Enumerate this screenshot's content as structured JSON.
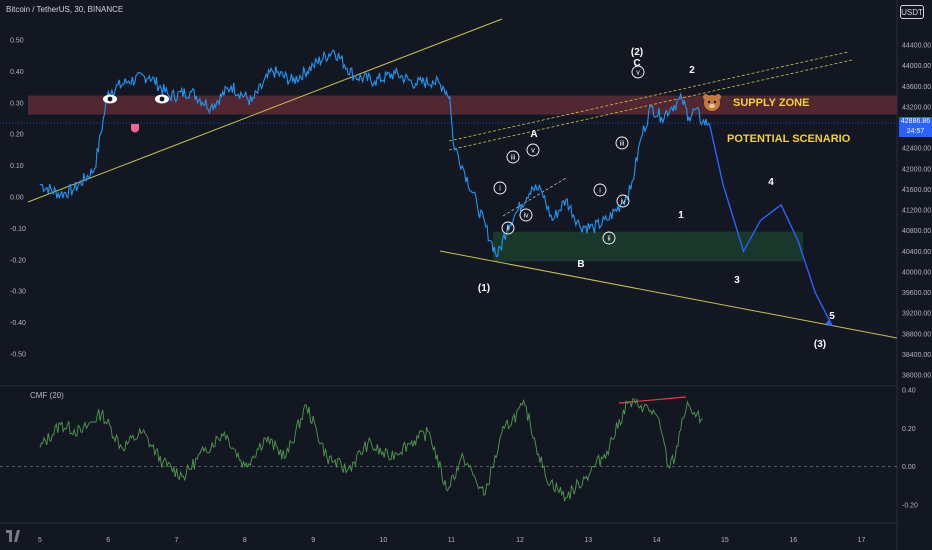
{
  "header": {
    "symbol_line": "Bitcoin / TetherUS, 30, BINANCE",
    "currency_button": "USDT",
    "last_price": "42886.86",
    "countdown": "24:57"
  },
  "colors": {
    "background": "#131722",
    "candle_line": "#2196f3",
    "supply_zone": "#5d2a35",
    "demand_zone": "#1c3b2c",
    "trendline": "#c9c24a",
    "scenario_path": "#2962ff",
    "labels_yellow": "#f5d131",
    "cmf_line": "#4f9a4c",
    "price_badge": "#2962ff"
  },
  "chart_data": [
    {
      "type": "line",
      "title": "Bitcoin / TetherUS, 30, BINANCE",
      "xlabel": "",
      "ylabel": "",
      "x_ticks": [
        "5",
        "6",
        "7",
        "8",
        "9",
        "10",
        "11",
        "12",
        "13",
        "14",
        "15",
        "16",
        "17"
      ],
      "left_axis": {
        "ticks": [
          "0.50",
          "0.40",
          "0.30",
          "0.20",
          "0.10",
          "0.00",
          "-0.10",
          "-0.20",
          "-0.30",
          "-0.40",
          "-0.50"
        ]
      },
      "right_axis": {
        "ylim": [
          37800,
          44800
        ],
        "ticks": [
          "44400.00",
          "44000.00",
          "43600.00",
          "43200.00",
          "42800.00",
          "42400.00",
          "42000.00",
          "41600.00",
          "41200.00",
          "40800.00",
          "40400.00",
          "40000.00",
          "39600.00",
          "39200.00",
          "38800.00",
          "38400.00",
          "38000.00"
        ]
      },
      "grid": false,
      "series": [
        {
          "x": [
            5.0,
            5.3,
            5.5,
            5.8,
            6.0,
            6.3,
            6.6,
            6.9,
            7.2,
            7.5,
            7.8,
            8.1,
            8.4,
            8.7,
            9.0,
            9.3,
            9.6,
            9.9,
            10.2,
            10.5,
            10.75,
            10.9,
            11.0,
            11.05,
            11.2,
            11.4,
            11.6,
            11.7,
            11.85,
            12.0,
            12.2,
            12.35,
            12.5,
            12.7,
            12.9,
            13.1,
            13.3,
            13.5,
            13.65,
            13.8,
            13.95,
            14.1,
            14.25,
            14.4,
            14.5,
            14.6,
            14.7,
            14.8
          ],
          "values": [
            41700,
            41500,
            41600,
            42000,
            43500,
            43700,
            43800,
            43400,
            43500,
            43200,
            43600,
            43300,
            43900,
            43700,
            44000,
            44300,
            43800,
            43700,
            43850,
            43650,
            43700,
            43600,
            43400,
            42500,
            42000,
            41300,
            40600,
            40300,
            40900,
            41200,
            41650,
            41550,
            41000,
            41400,
            40900,
            40850,
            41000,
            41300,
            41600,
            42600,
            43200,
            43000,
            43200,
            43350,
            43000,
            43150,
            42900,
            42886
          ]
        }
      ],
      "projection": {
        "x": [
          14.8,
          15.0,
          15.3,
          15.55,
          15.85,
          16.1,
          16.35,
          16.6
        ],
        "values": [
          42886,
          41700,
          40400,
          41000,
          41300,
          40600,
          39600,
          38950
        ]
      },
      "zones": [
        {
          "label": "SUPPLY ZONE",
          "from": 43050,
          "to": 43420
        },
        {
          "label": "",
          "from": 40200,
          "to": 40780
        }
      ],
      "annotations": {
        "potential_scenario": "POTENTIAL SCENARIO",
        "wave_1_paren": "(1)",
        "wave_2_paren": "(2)",
        "wave_3_paren": "(3)",
        "wave_A": "A",
        "wave_B": "B",
        "wave_C": "C",
        "n1": "1",
        "n2": "2",
        "n3": "3",
        "n4": "4",
        "n5": "5",
        "circ_i_1": "i",
        "circ_ii_1": "ii",
        "circ_iii_1": "iii",
        "circ_iv_1": "iv",
        "circ_v_1": "v",
        "circ_i_2": "i",
        "circ_ii_2": "ii",
        "circ_iii_2": "iii",
        "circ_iv_2": "iv",
        "circ_v_2": "v"
      }
    },
    {
      "type": "line",
      "title": "CMF (20)",
      "ylim": [
        -0.25,
        0.42
      ],
      "ticks": [
        "0.40",
        "0.20",
        "0.00",
        "-0.20"
      ],
      "series": [
        {
          "x": [
            5.0,
            5.3,
            5.6,
            5.9,
            6.2,
            6.5,
            6.8,
            7.1,
            7.4,
            7.7,
            8.0,
            8.3,
            8.6,
            8.9,
            9.2,
            9.5,
            9.8,
            10.1,
            10.4,
            10.7,
            10.95,
            11.2,
            11.5,
            11.8,
            12.1,
            12.4,
            12.7,
            13.0,
            13.3,
            13.6,
            13.8,
            14.0,
            14.1,
            14.2,
            14.3,
            14.4,
            14.5,
            14.6,
            14.7
          ],
          "values": [
            0.1,
            0.22,
            0.18,
            0.28,
            0.1,
            0.18,
            0.02,
            -0.05,
            0.08,
            0.18,
            0.0,
            0.15,
            0.05,
            0.32,
            0.05,
            -0.02,
            0.12,
            0.05,
            0.12,
            0.18,
            -0.12,
            0.05,
            -0.15,
            0.2,
            0.32,
            -0.05,
            -0.16,
            -0.05,
            0.08,
            0.33,
            0.32,
            0.28,
            0.18,
            0.0,
            0.05,
            0.25,
            0.32,
            0.26,
            0.25
          ]
        }
      ]
    }
  ]
}
